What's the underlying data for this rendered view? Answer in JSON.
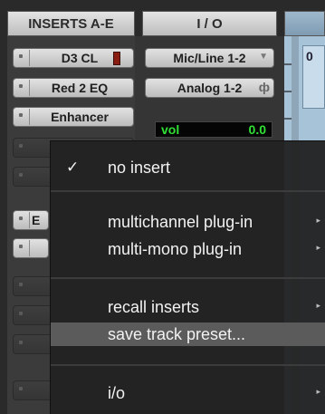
{
  "headers": {
    "inserts": "INSERTS A-E",
    "io": "I / O"
  },
  "inserts": [
    {
      "label": "D3 CL",
      "has_meter": true
    },
    {
      "label": "Red 2 EQ",
      "has_meter": false
    },
    {
      "label": "Enhancer",
      "has_meter": false
    }
  ],
  "partial_insert_letter": "E",
  "io": {
    "input": "Mic/Line 1-2",
    "output": "Analog 1-2"
  },
  "volume": {
    "label": "vol",
    "value": "0.0"
  },
  "track_glyph": "0",
  "menu": {
    "no_insert": "no insert",
    "multichannel": "multichannel plug-in",
    "multimono": "multi-mono plug-in",
    "recall": "recall inserts",
    "save_preset": "save track preset...",
    "io": "i/o",
    "check_glyph": "✓",
    "submenu_glyph": "▸"
  },
  "highlighted_item": "save_preset"
}
